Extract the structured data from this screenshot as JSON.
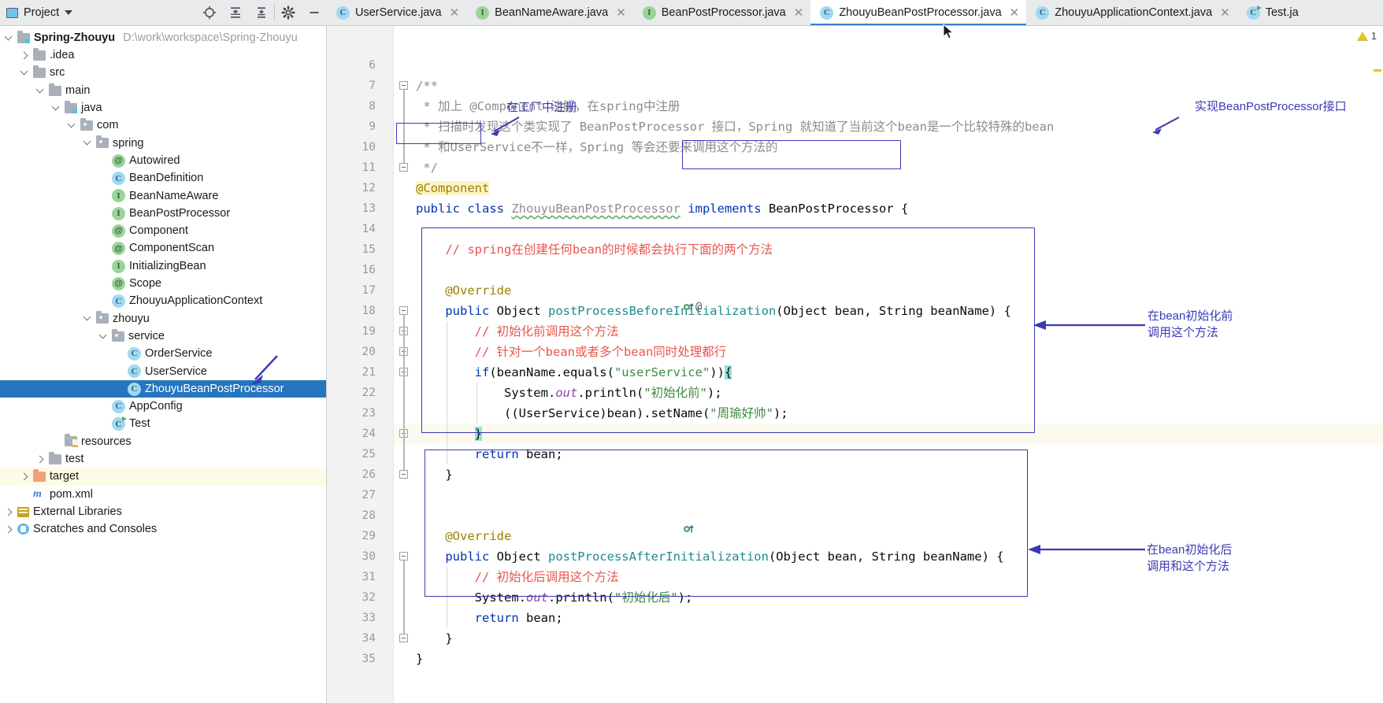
{
  "project_toolbar": {
    "title": "Project",
    "icons": [
      "locate-icon",
      "expand-all-icon",
      "collapse-all-icon",
      "settings-gear-icon",
      "hide-panel-icon"
    ]
  },
  "tabs": [
    {
      "label": "UserService.java",
      "icon": "class-icon",
      "kind": "class",
      "active": false
    },
    {
      "label": "BeanNameAware.java",
      "icon": "interface-icon",
      "kind": "interface",
      "active": false
    },
    {
      "label": "BeanPostProcessor.java",
      "icon": "interface-icon",
      "kind": "interface",
      "active": false
    },
    {
      "label": "ZhouyuBeanPostProcessor.java",
      "icon": "class-icon",
      "kind": "class",
      "active": true
    },
    {
      "label": "ZhouyuApplicationContext.java",
      "icon": "class-icon",
      "kind": "class",
      "active": false
    },
    {
      "label": "Test.ja",
      "icon": "runnable-class-icon",
      "kind": "runclass",
      "active": false
    }
  ],
  "tree": [
    {
      "label": "Spring-Zhouyu",
      "path": "D:\\work\\workspace\\Spring-Zhouyu",
      "indent": 0,
      "arrow": "open",
      "icon": "project-folder-icon",
      "style": "project"
    },
    {
      "label": ".idea",
      "indent": 1,
      "arrow": "closed",
      "icon": "folder-icon"
    },
    {
      "label": "src",
      "indent": 1,
      "arrow": "open",
      "icon": "folder-icon"
    },
    {
      "label": "main",
      "indent": 2,
      "arrow": "open",
      "icon": "folder-icon"
    },
    {
      "label": "java",
      "indent": 3,
      "arrow": "open",
      "icon": "source-folder-icon"
    },
    {
      "label": "com",
      "indent": 4,
      "arrow": "open",
      "icon": "package-folder-icon"
    },
    {
      "label": "spring",
      "indent": 5,
      "arrow": "open",
      "icon": "package-folder-icon"
    },
    {
      "label": "Autowired",
      "indent": 6,
      "arrow": "none",
      "icon": "annotation-icon"
    },
    {
      "label": "BeanDefinition",
      "indent": 6,
      "arrow": "none",
      "icon": "class-icon"
    },
    {
      "label": "BeanNameAware",
      "indent": 6,
      "arrow": "none",
      "icon": "interface-icon"
    },
    {
      "label": "BeanPostProcessor",
      "indent": 6,
      "arrow": "none",
      "icon": "interface-icon"
    },
    {
      "label": "Component",
      "indent": 6,
      "arrow": "none",
      "icon": "annotation-icon"
    },
    {
      "label": "ComponentScan",
      "indent": 6,
      "arrow": "none",
      "icon": "annotation-icon"
    },
    {
      "label": "InitializingBean",
      "indent": 6,
      "arrow": "none",
      "icon": "interface-icon"
    },
    {
      "label": "Scope",
      "indent": 6,
      "arrow": "none",
      "icon": "annotation-icon"
    },
    {
      "label": "ZhouyuApplicationContext",
      "indent": 6,
      "arrow": "none",
      "icon": "class-icon"
    },
    {
      "label": "zhouyu",
      "indent": 5,
      "arrow": "open",
      "icon": "package-folder-icon"
    },
    {
      "label": "service",
      "indent": 6,
      "arrow": "open",
      "icon": "package-folder-icon"
    },
    {
      "label": "OrderService",
      "indent": 7,
      "arrow": "none",
      "icon": "class-icon"
    },
    {
      "label": "UserService",
      "indent": 7,
      "arrow": "none",
      "icon": "class-icon"
    },
    {
      "label": "ZhouyuBeanPostProcessor",
      "indent": 7,
      "arrow": "none",
      "icon": "class-icon",
      "selected": true
    },
    {
      "label": "AppConfig",
      "indent": 6,
      "arrow": "none",
      "icon": "class-icon"
    },
    {
      "label": "Test",
      "indent": 6,
      "arrow": "none",
      "icon": "runnable-class-icon"
    },
    {
      "label": "resources",
      "indent": 3,
      "arrow": "none",
      "icon": "resources-folder-icon"
    },
    {
      "label": "test",
      "indent": 2,
      "arrow": "closed",
      "icon": "folder-icon"
    },
    {
      "label": "target",
      "indent": 1,
      "arrow": "closed",
      "icon": "excluded-folder-icon",
      "excluded": true
    },
    {
      "label": "pom.xml",
      "indent": 1,
      "arrow": "none",
      "icon": "maven-icon"
    },
    {
      "label": "External Libraries",
      "indent": 0,
      "arrow": "closed",
      "icon": "library-icon"
    },
    {
      "label": "Scratches and Consoles",
      "indent": 0,
      "arrow": "closed",
      "icon": "scratches-icon"
    }
  ],
  "editor": {
    "first_line": 6,
    "last_line": 35,
    "caret_line": 24,
    "warning_count": "1",
    "lines": {
      "6": "",
      "7": "/**",
      "8": " * 加上 @Component 注解，在spring中注册",
      "9": " * 扫描时发现这个类实现了 BeanPostProcessor 接口，Spring 就知道了当前这个bean是一个比较特殊的bean",
      "10": " * 和UserService不一样，Spring 等会还要来调用这个方法的",
      "11": " */",
      "12": "@Component",
      "13": "public class ZhouyuBeanPostProcessor implements BeanPostProcessor {",
      "14": "",
      "15": "    // spring在创建任何bean的时候都会执行下面的两个方法",
      "16": "",
      "17": "    @Override",
      "18": "    public Object postProcessBeforeInitialization(Object bean, String beanName) {",
      "19": "        // 初始化前调用这个方法",
      "20": "        // 针对一个bean或者多个bean同时处理都行",
      "21": "        if(beanName.equals(\"userService\")){",
      "22": "            System.out.println(\"初始化前\");",
      "23": "            ((UserService)bean).setName(\"周瑜好帅\");",
      "24": "        }",
      "25": "        return bean;",
      "26": "    }",
      "27": "",
      "28": "",
      "29": "    @Override",
      "30": "    public Object postProcessAfterInitialization(Object bean, String beanName) {",
      "31": "        // 初始化后调用这个方法",
      "32": "        System.out.println(\"初始化后\");",
      "33": "        return bean;",
      "34": "    }",
      "35": "}"
    }
  },
  "annotations": [
    {
      "name": "register-in-factory-note",
      "text": "在工厂中注册",
      "color": "#3a3ab5"
    },
    {
      "name": "implements-bpp-note",
      "text": "实现BeanPostProcessor接口",
      "color": "#3a3ab5"
    },
    {
      "name": "before-init-note",
      "text": "在bean初始化前\n调用这个方法",
      "color": "#3a3ab5"
    },
    {
      "name": "after-init-note",
      "text": "在bean初始化后\n调用和这个方法",
      "color": "#3a3ab5"
    }
  ],
  "colors": {
    "selection_blue": "#2675bf",
    "annotation_blue": "#3a3ab5",
    "keyword": "#0033b3",
    "string": "#3d8a3d",
    "comment_gray": "#8c8c8c",
    "comment_red": "#e8564f",
    "method_teal": "#1f8a8a",
    "annotation_olive": "#9e8000",
    "caret_line_bg": "#fcfaef",
    "excluded_bg": "#fdfbe6"
  }
}
